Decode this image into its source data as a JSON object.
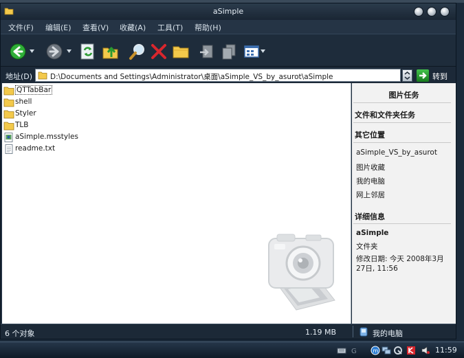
{
  "window": {
    "title": "aSimple"
  },
  "menu": [
    "文件(F)",
    "编辑(E)",
    "查看(V)",
    "收藏(A)",
    "工具(T)",
    "帮助(H)"
  ],
  "toolbar": {
    "buttons": [
      {
        "name": "back-button",
        "icon": "back-arrow-icon"
      },
      {
        "name": "forward-button",
        "icon": "forward-arrow-icon"
      },
      {
        "name": "refresh-button",
        "icon": "refresh-icon"
      },
      {
        "name": "up-button",
        "icon": "folder-up-icon"
      },
      {
        "name": "search-button",
        "icon": "search-icon"
      },
      {
        "name": "stop-button",
        "icon": "close-icon"
      },
      {
        "name": "folders-button",
        "icon": "folder-icon"
      },
      {
        "name": "move-to-button",
        "icon": "move-to-icon"
      },
      {
        "name": "copy-to-button",
        "icon": "copy-to-icon"
      },
      {
        "name": "views-button",
        "icon": "views-icon"
      }
    ]
  },
  "address": {
    "label": "地址(D)",
    "path": "D:\\Documents and Settings\\Administrator\\桌面\\aSimple_VS_by_asurot\\aSimple",
    "go_label": "转到"
  },
  "files": [
    {
      "name": "QTTabBar",
      "type": "folder",
      "selected": true
    },
    {
      "name": "shell",
      "type": "folder"
    },
    {
      "name": "Styler",
      "type": "folder"
    },
    {
      "name": "TLB",
      "type": "folder"
    },
    {
      "name": "aSimple.msstyles",
      "type": "msstyles"
    },
    {
      "name": "readme.txt",
      "type": "text"
    }
  ],
  "taskpane": {
    "picture_tasks": "图片任务",
    "file_tasks": "文件和文件夹任务",
    "other_places": {
      "heading": "其它位置",
      "links": [
        "aSimple_VS_by_asurot",
        "图片收藏",
        "我的电脑",
        "网上邻居"
      ]
    },
    "details": {
      "heading": "详细信息",
      "name": "aSimple",
      "type": "文件夹",
      "modified_line1": "修改日期: 今天 2008年3月",
      "modified_line2": "27日, 11:56"
    }
  },
  "status": {
    "count": "6 个对象",
    "size": "1.19 MB",
    "location": "我的电脑"
  },
  "taskbar": {
    "clock": "11:59"
  },
  "colors": {
    "chrome": "#202e3e",
    "menu_text": "#d8e2ea",
    "taskpane_bg": "#f2f2f2",
    "go_green": "#2a9a31",
    "stop_red": "#d8262d",
    "folder_yellow": "#f3c94b"
  }
}
